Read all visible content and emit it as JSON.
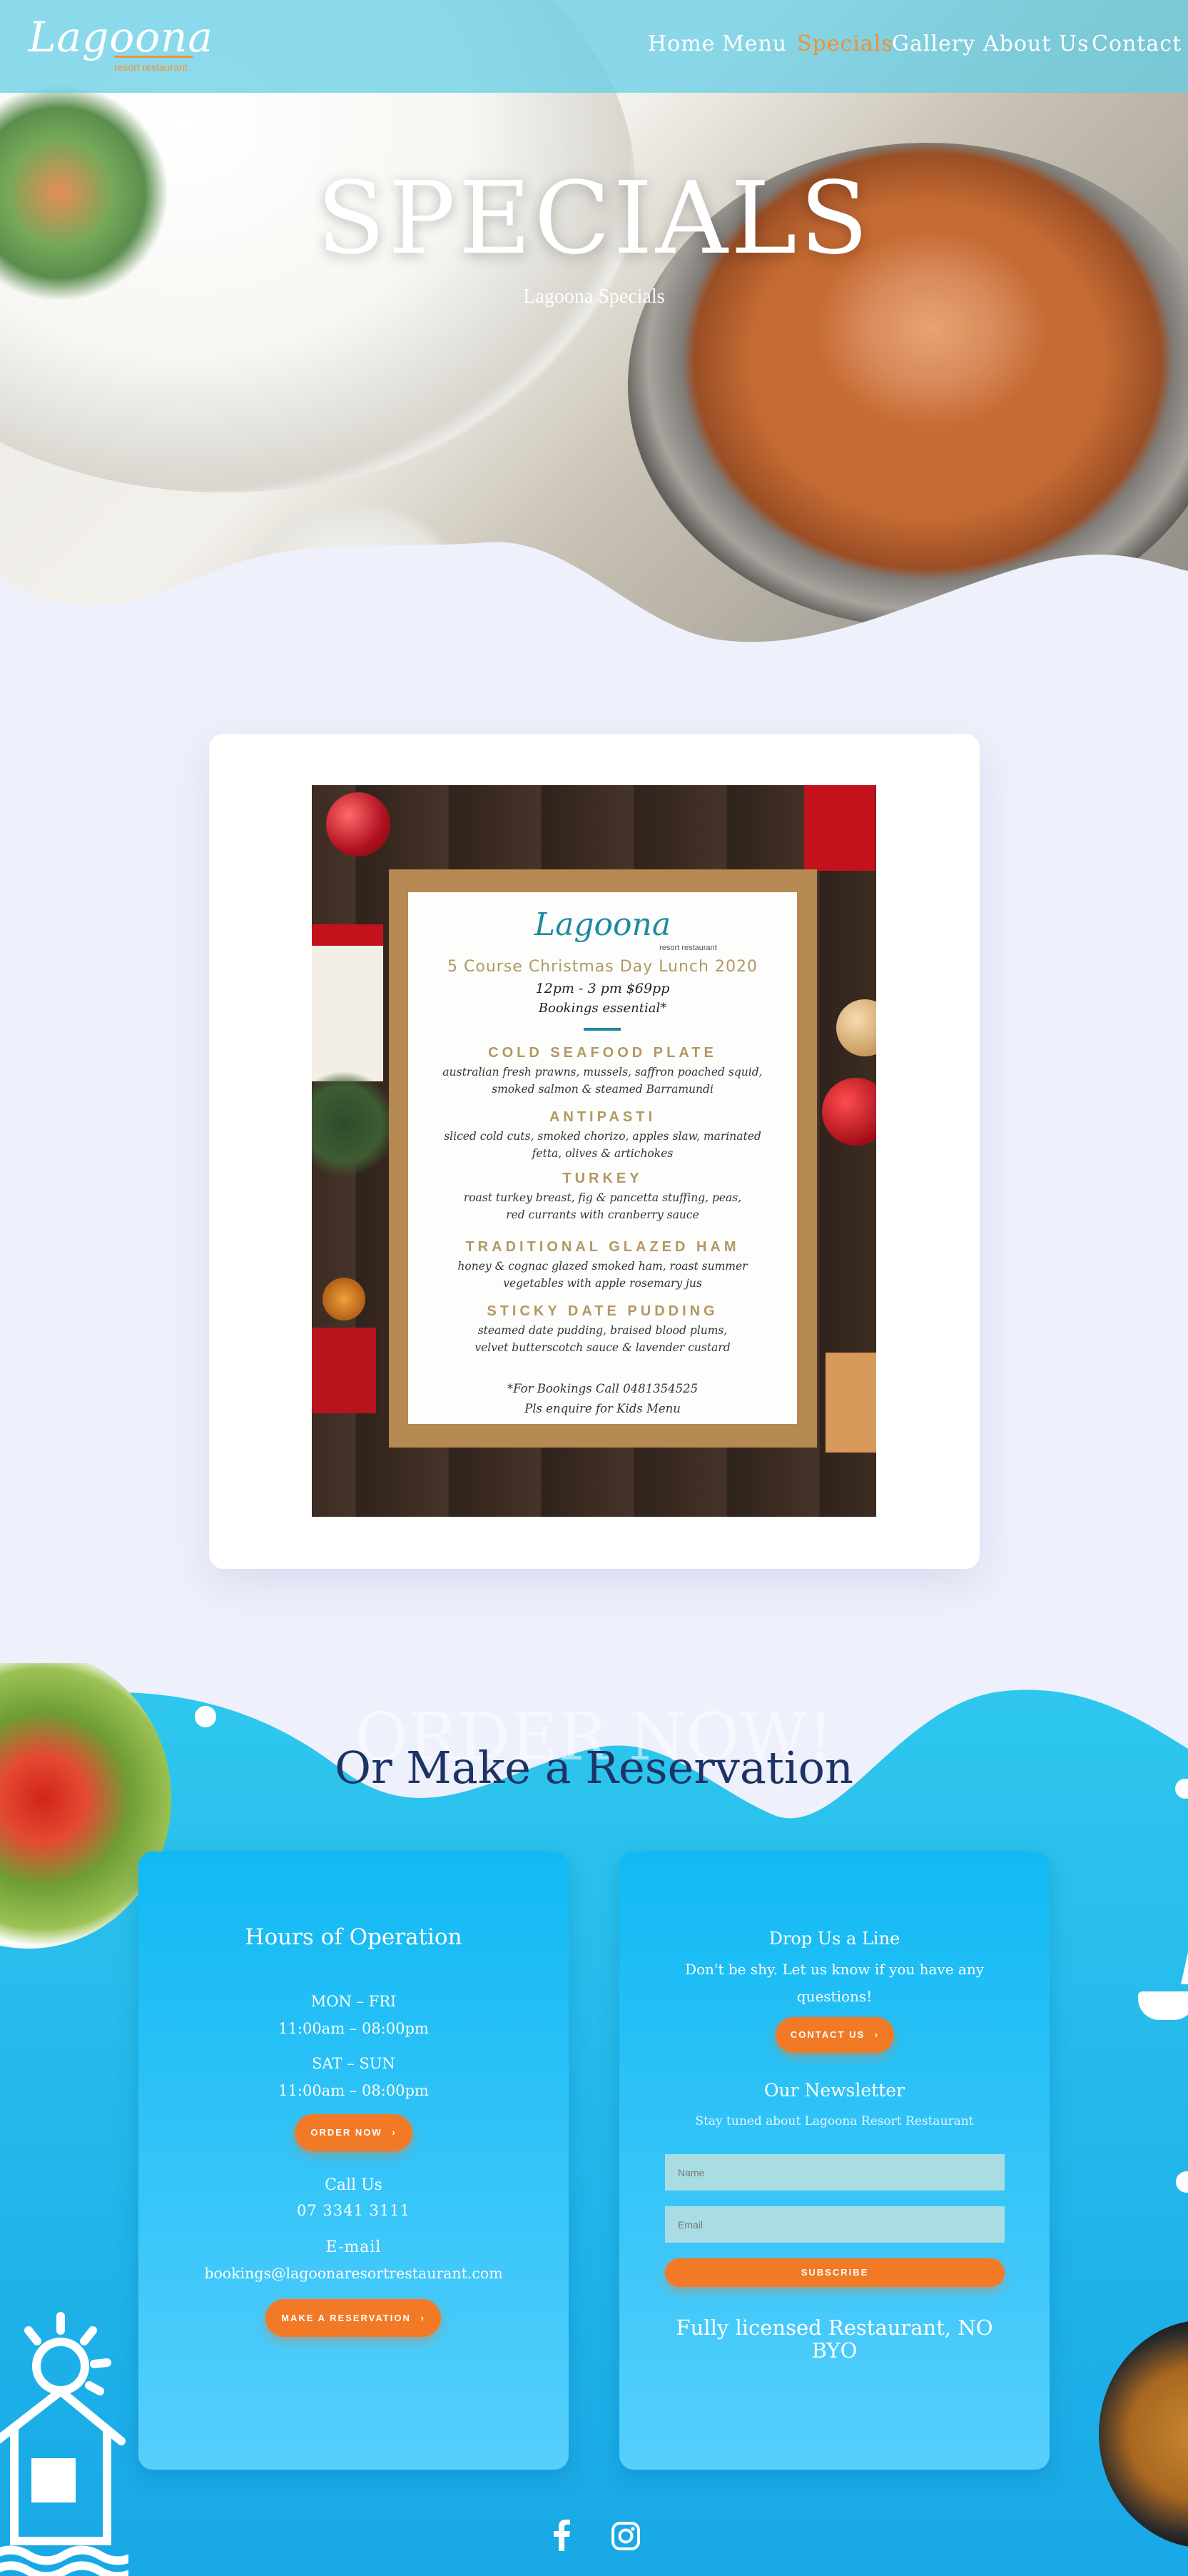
{
  "brand": {
    "name": "Lagoona",
    "tagline": "resort restaurant"
  },
  "nav": {
    "items": [
      "Home",
      "Menu",
      "Specials",
      "Gallery",
      "About Us",
      "Contact"
    ],
    "active": "Specials"
  },
  "hero": {
    "title": "SPECIALS",
    "subtitle": "Lagoona Specials"
  },
  "flyer": {
    "logo": "Lagoona",
    "logo_sub": "resort restaurant",
    "title": "5 Course Christmas Day Lunch 2020",
    "time": "12pm - 3 pm $69pp",
    "bookings": "Bookings essential*",
    "courses": [
      {
        "name": "COLD SEAFOOD PLATE",
        "lines": [
          "australian fresh prawns, mussels, saffron poached squid,",
          "smoked salmon & steamed Barramundi"
        ]
      },
      {
        "name": "ANTIPASTI",
        "lines": [
          "sliced cold cuts, smoked chorizo, apples slaw, marinated",
          "fetta, olives & artichokes"
        ]
      },
      {
        "name": "TURKEY",
        "lines": [
          "roast turkey breast, fig & pancetta stuffing, peas,",
          "red currants with cranberry sauce"
        ]
      },
      {
        "name": "TRADITIONAL GLAZED HAM",
        "lines": [
          "honey & cognac glazed smoked ham, roast summer",
          "vegetables with apple rosemary jus"
        ]
      },
      {
        "name": "STICKY DATE PUDDING",
        "lines": [
          "steamed date pudding, braised blood plums,",
          "velvet butterscotch sauce & lavender custard"
        ]
      }
    ],
    "footer1": "*For Bookings Call 0481354525",
    "footer2": "Pls enquire for Kids Menu"
  },
  "order": {
    "ghost_title": "ORDER NOW!",
    "title": "Or Make a Reservation"
  },
  "hours_card": {
    "title": "Hours of Operation",
    "weekday_label": "MON – FRI",
    "weekday_hours": "11:00am – 08:00pm",
    "weekend_label": "SAT – SUN",
    "weekend_hours": "11:00am – 08:00pm",
    "order_button": "ORDER NOW",
    "call_label": "Call Us",
    "phone": "07 3341 3111",
    "email_label": "E-mail",
    "email": "bookings@lagoonaresortrestaurant.com",
    "reservation_button": "MAKE A RESERVATION"
  },
  "contact_card": {
    "title": "Drop Us a Line",
    "text": "Don't be shy. Let us know if you have any questions!",
    "contact_button": "CONTACT US",
    "newsletter_title": "Our Newsletter",
    "newsletter_text": "Stay tuned about Lagoona Resort Restaurant",
    "name_placeholder": "Name",
    "email_placeholder": "Email",
    "subscribe_button": "SUBSCRIBE",
    "licensed": "Fully licensed Restaurant, NO BYO"
  },
  "social": {
    "icons": [
      "facebook-icon",
      "instagram-icon"
    ]
  },
  "colors": {
    "accent": "#f27a27",
    "nav_bg": "#5fcde6",
    "card_blue": "#11b9f4",
    "dark_title": "#1d3366",
    "page_bg": "#eef0fb"
  }
}
